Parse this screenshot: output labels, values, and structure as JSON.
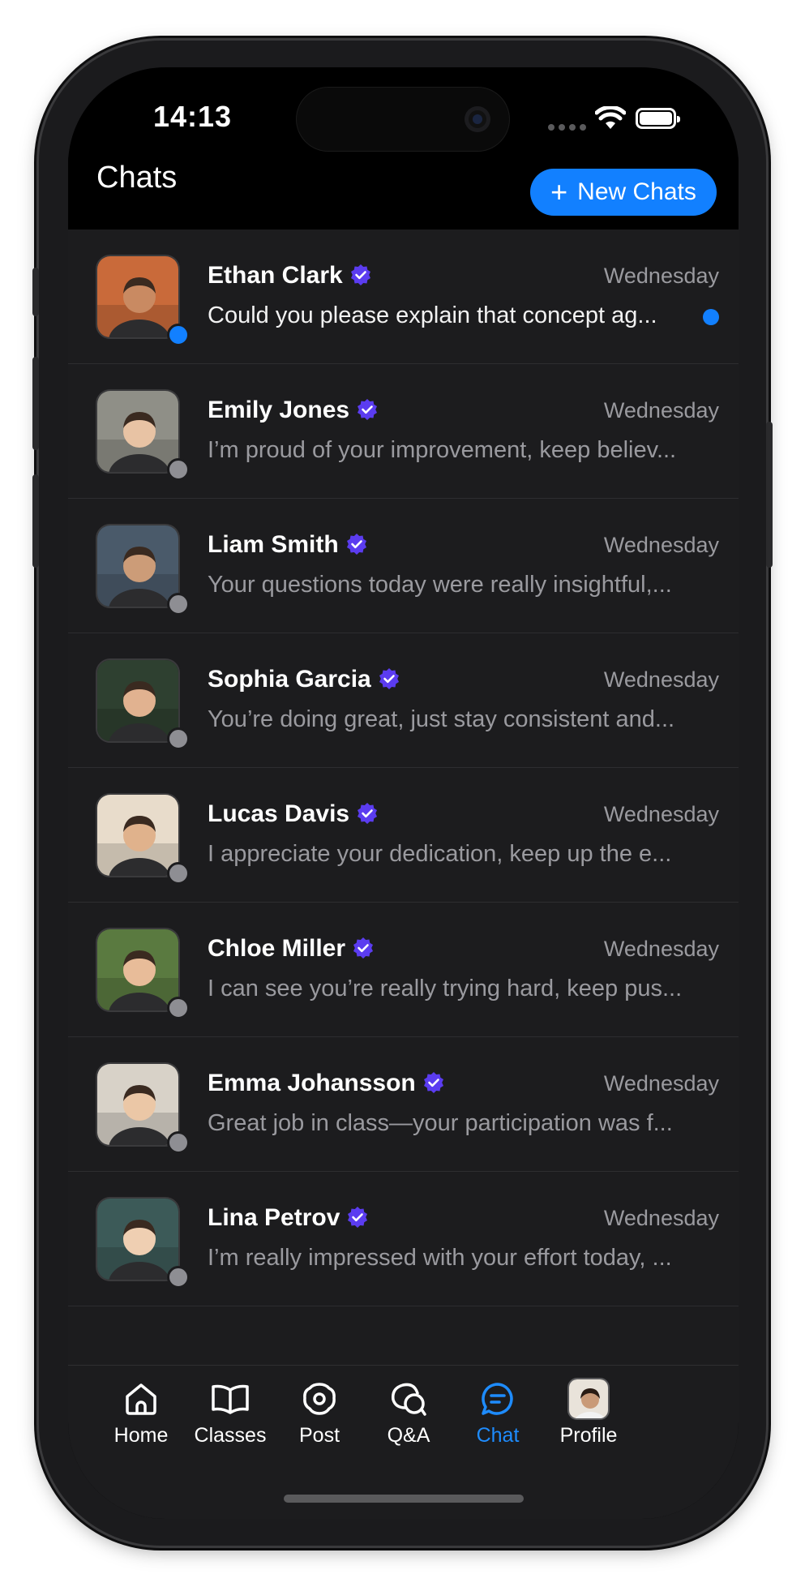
{
  "status_bar": {
    "time": "14:13"
  },
  "header": {
    "title": "Chats",
    "new_chat_label": "New Chats",
    "accent": "#1280ff"
  },
  "chats": [
    {
      "name": "Ethan Clark",
      "day": "Wednesday",
      "message": "Could you please explain that concept ag...",
      "unread": true,
      "online": true,
      "skin": "#c98a62",
      "bg": "#c96a3a"
    },
    {
      "name": "Emily Jones",
      "day": "Wednesday",
      "message": "I’m proud of your improvement, keep believ...",
      "unread": false,
      "online": false,
      "skin": "#e8c3a4",
      "bg": "#8f8f87"
    },
    {
      "name": "Liam  Smith",
      "day": "Wednesday",
      "message": "Your questions today were really insightful,...",
      "unread": false,
      "online": false,
      "skin": "#cc9c78",
      "bg": "#4a5a6a"
    },
    {
      "name": "Sophia Garcia",
      "day": "Wednesday",
      "message": "You’re doing great, just stay consistent and...",
      "unread": false,
      "online": false,
      "skin": "#e1b290",
      "bg": "#2e4030"
    },
    {
      "name": "Lucas Davis",
      "day": "Wednesday",
      "message": "I appreciate your dedication, keep up the e...",
      "unread": false,
      "online": false,
      "skin": "#e0b28c",
      "bg": "#e8dccb"
    },
    {
      "name": "Chloe Miller",
      "day": "Wednesday",
      "message": "I can see you’re really trying hard, keep pus...",
      "unread": false,
      "online": false,
      "skin": "#e8bc99",
      "bg": "#5a7a40"
    },
    {
      "name": "Emma Johansson",
      "day": "Wednesday",
      "message": "Great job in class—your participation was f...",
      "unread": false,
      "online": false,
      "skin": "#ebc7a6",
      "bg": "#d8d2c8"
    },
    {
      "name": "Lina Petrov",
      "day": "Wednesday",
      "message": "I’m really impressed with your effort today, ...",
      "unread": false,
      "online": false,
      "skin": "#efcfb2",
      "bg": "#3c5a58"
    }
  ],
  "tabs": [
    {
      "label": "Home",
      "icon": "home-icon"
    },
    {
      "label": "Classes",
      "icon": "book-icon"
    },
    {
      "label": "Post",
      "icon": "post-icon"
    },
    {
      "label": "Q&A",
      "icon": "qa-icon"
    },
    {
      "label": "Chat",
      "icon": "chat-icon",
      "active": true
    },
    {
      "label": "Profile",
      "icon": "profile-avatar"
    }
  ],
  "colors": {
    "verified": "#5b3cf0",
    "online": "#1280ff",
    "offline": "#8e8e93",
    "active_tab": "#1e8cff"
  }
}
